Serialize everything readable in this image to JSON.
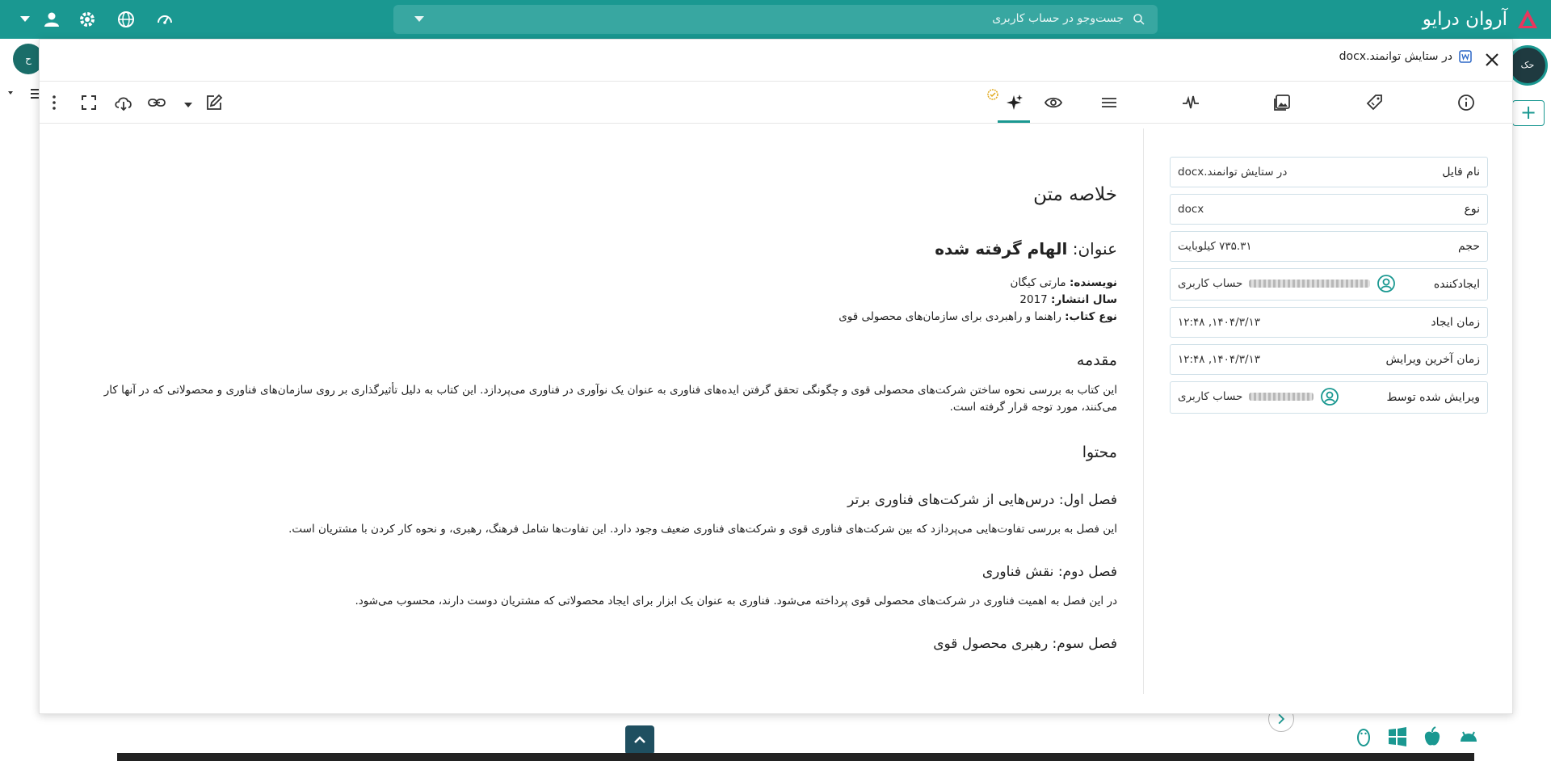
{
  "app": {
    "brand_name": "آروان درایو",
    "search_placeholder": "جست‌وجو در حساب کاربری",
    "colors": {
      "primary": "#1a9891",
      "search_bg": "#38a7a1"
    }
  },
  "background": {
    "left_avatar_text": "ح",
    "right_avatar_text": "حک",
    "add_button_label": "+"
  },
  "viewer": {
    "file_title": "در ستایش توانمند.docx",
    "close_icon": "close-icon",
    "toolbar_icons_right_to_left": [
      "info-icon",
      "tag-icon",
      "image-icon",
      "activity-icon",
      "menu-icon",
      "eye-icon",
      "ai-sparkle-icon"
    ],
    "toolbar_icons_left_to_right": [
      "more-vertical-icon",
      "fullscreen-icon",
      "cloud-download-icon",
      "link-icon",
      "dropdown-icon",
      "edit-icon"
    ],
    "active_tab": "ai-sparkle-icon"
  },
  "summary": {
    "heading": "خلاصه متن",
    "title_prefix": "عنوان: ",
    "title_value": "الهام گرفته شده",
    "author_label": "نویسنده:",
    "author_value": " مارتی کیگان",
    "year_label": "سال انتشار:",
    "year_value": " 2017",
    "book_type_label": "نوع کتاب:",
    "book_type_value": " راهنما و راهبردی برای سازمان‌های محصولی قوی",
    "intro_heading": "مقدمه",
    "intro_text": "این کتاب به بررسی نحوه ساختن شرکت‌های محصولی قوی و چگونگی تحقق گرفتن ایده‌های فناوری به عنوان یک نوآوری در فناوری می‌پردازد. این کتاب به دلیل تأثیرگذاری بر روی سازمان‌های فناوری و محصولاتی که در آنها کار می‌کنند، مورد توجه قرار گرفته است.",
    "content_heading": "محتوا",
    "chapter1_title": "فصل اول: درس‌هایی از شرکت‌های فناوری برتر",
    "chapter1_text": "این فصل به بررسی تفاوت‌هایی می‌پردازد که بین شرکت‌های فناوری قوی و شرکت‌های فناوری ضعیف وجود دارد. این تفاوت‌ها شامل فرهنگ، رهبری، و نحوه کار کردن با مشتریان است.",
    "chapter2_title": "فصل دوم: نقش فناوری",
    "chapter2_text": "در این فصل به اهمیت فناوری در شرکت‌های محصولی قوی پرداخته می‌شود. فناوری به عنوان یک ابزار برای ایجاد محصولاتی که مشتریان دوست دارند، محسوب می‌شود.",
    "chapter3_title": "فصل سوم: رهبری محصول قوی"
  },
  "info": {
    "file_name_label": "نام فایل",
    "file_name_value": "در ستایش توانمند.docx",
    "type_label": "نوع",
    "type_value": "docx",
    "size_label": "حجم",
    "size_value": "۷۳۵.۳۱ کیلوبایت",
    "creator_label": "ایجادکننده",
    "creator_value": "حساب کاربری",
    "created_label": "زمان ایجاد",
    "created_value": "۱۴۰۴/۳/۱۳, ۱۲:۴۸",
    "modified_label": "زمان آخرین ویرایش",
    "modified_value": "۱۴۰۴/۳/۱۳, ۱۲:۴۸",
    "editor_label": "ویرایش شده توسط",
    "editor_value": "حساب کاربری"
  }
}
